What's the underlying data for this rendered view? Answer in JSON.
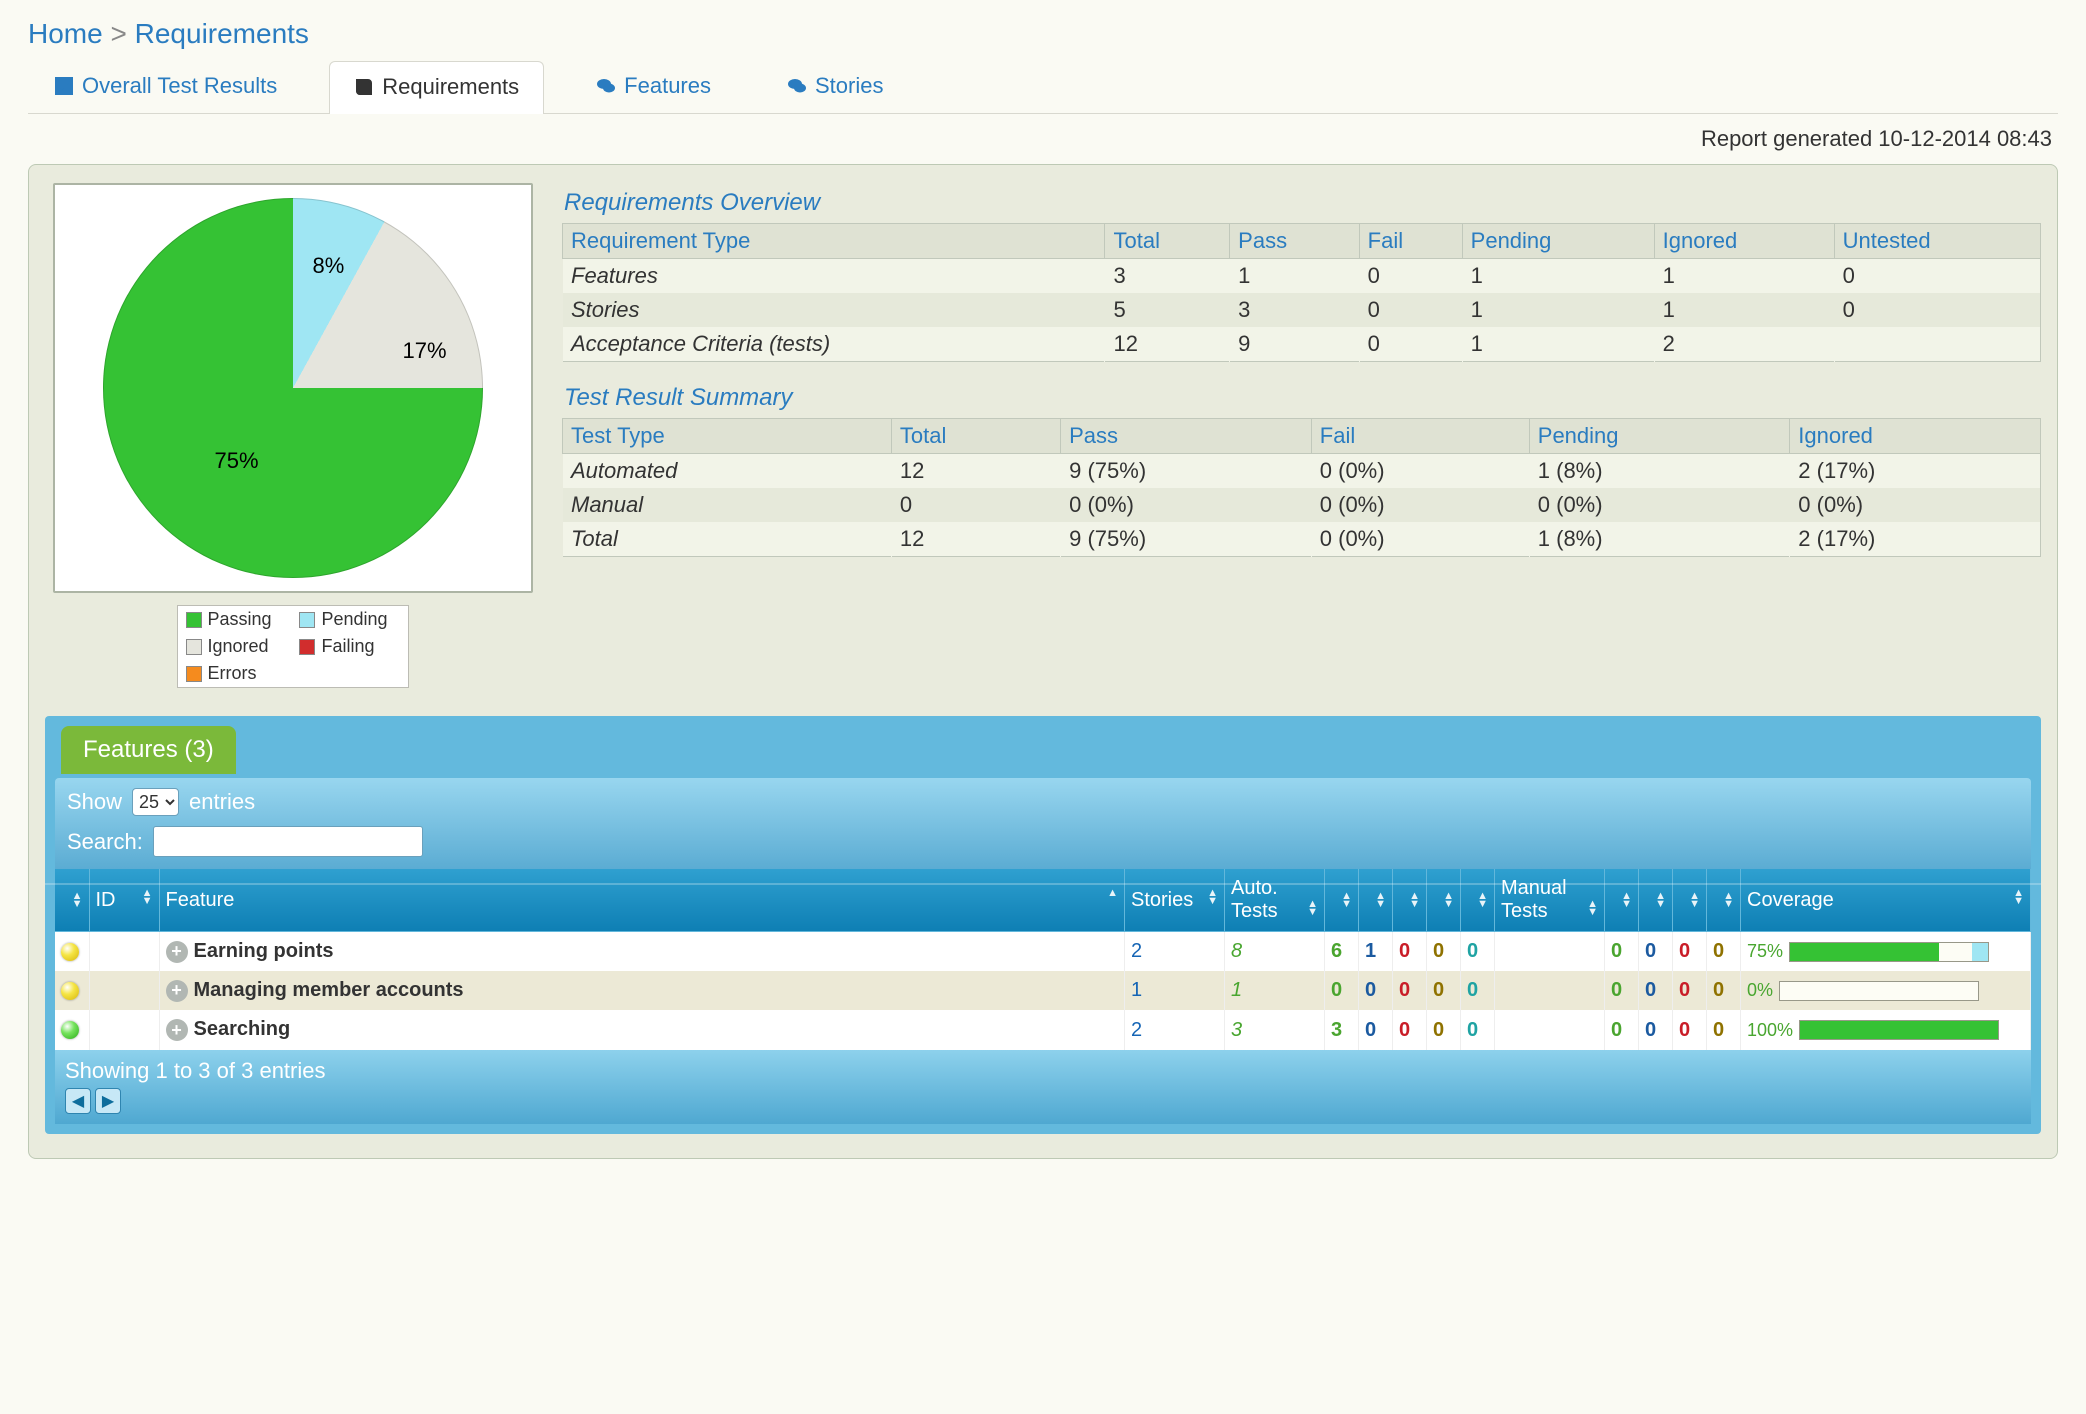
{
  "breadcrumb": {
    "home": "Home",
    "sep": ">",
    "current": "Requirements"
  },
  "tabs": {
    "overall": "Overall Test Results",
    "requirements": "Requirements",
    "features": "Features",
    "stories": "Stories"
  },
  "report_ts": "Report generated 10-12-2014 08:43",
  "pie_legend": {
    "passing": "Passing",
    "pending": "Pending",
    "ignored": "Ignored",
    "failing": "Failing",
    "errors": "Errors"
  },
  "pie_labels": {
    "pending": "8%",
    "ignored": "17%",
    "passing": "75%"
  },
  "overview_title": "Requirements Overview",
  "overview_headers": {
    "type": "Requirement Type",
    "total": "Total",
    "pass": "Pass",
    "fail": "Fail",
    "pending": "Pending",
    "ignored": "Ignored",
    "untested": "Untested"
  },
  "overview_rows": [
    {
      "type": "Features",
      "total": "3",
      "pass": "1",
      "fail": "0",
      "pending": "1",
      "ignored": "1",
      "untested": "0"
    },
    {
      "type": "Stories",
      "total": "5",
      "pass": "3",
      "fail": "0",
      "pending": "1",
      "ignored": "1",
      "untested": "0"
    },
    {
      "type": "Acceptance Criteria (tests)",
      "total": "12",
      "pass": "9",
      "fail": "0",
      "pending": "1",
      "ignored": "2",
      "untested": ""
    }
  ],
  "summary_title": "Test Result Summary",
  "summary_headers": {
    "type": "Test Type",
    "total": "Total",
    "pass": "Pass",
    "fail": "Fail",
    "pending": "Pending",
    "ignored": "Ignored"
  },
  "summary_rows": [
    {
      "type": "Automated",
      "total": "12",
      "pass": "9 (75%)",
      "fail": "0 (0%)",
      "pending": "1 (8%)",
      "ignored": "2 (17%)"
    },
    {
      "type": "Manual",
      "total": "0",
      "pass": "0 (0%)",
      "fail": "0 (0%)",
      "pending": "0 (0%)",
      "ignored": "0 (0%)"
    },
    {
      "type": "Total",
      "total": "12",
      "pass": "9 (75%)",
      "fail": "0 (0%)",
      "pending": "1 (8%)",
      "ignored": "2 (17%)"
    }
  ],
  "grid_title": "Features (3)",
  "grid_show_label_pre": "Show",
  "grid_show_value": "25",
  "grid_show_label_post": "entries",
  "grid_search_label": "Search:",
  "grid_search_value": "",
  "grid_headers": {
    "status": "",
    "id": "ID",
    "feature": "Feature",
    "stories": "Stories",
    "auto_tests": "Auto.\nTests",
    "manual_tests": "Manual\nTests",
    "coverage": "Coverage"
  },
  "features": [
    {
      "status": "yellow",
      "id": "",
      "name": "Earning points",
      "stories": "2",
      "auto_tests": "8",
      "a": [
        "6",
        "1",
        "0",
        "0",
        "0"
      ],
      "m": [
        "0",
        "0",
        "0",
        "0"
      ],
      "manual_tests": "",
      "coverage_pct": "75%",
      "coverage_fill": 75,
      "coverage_extra": 8
    },
    {
      "status": "yellow",
      "id": "",
      "name": "Managing member accounts",
      "stories": "1",
      "auto_tests": "1",
      "a": [
        "0",
        "0",
        "0",
        "0",
        "0"
      ],
      "m": [
        "0",
        "0",
        "0",
        "0"
      ],
      "manual_tests": "",
      "coverage_pct": "0%",
      "coverage_fill": 0,
      "coverage_extra": 0
    },
    {
      "status": "green",
      "id": "",
      "name": "Searching",
      "stories": "2",
      "auto_tests": "3",
      "a": [
        "3",
        "0",
        "0",
        "0",
        "0"
      ],
      "m": [
        "0",
        "0",
        "0",
        "0"
      ],
      "manual_tests": "",
      "coverage_pct": "100%",
      "coverage_fill": 100,
      "coverage_extra": 0
    }
  ],
  "grid_footer": "Showing 1 to 3 of 3 entries",
  "chart_data": {
    "type": "pie",
    "title": "",
    "slices": [
      {
        "label": "Passing",
        "value": 75,
        "color": "#35c234"
      },
      {
        "label": "Pending",
        "value": 8,
        "color": "#9fe6f3"
      },
      {
        "label": "Ignored",
        "value": 17,
        "color": "#e5e5dd"
      },
      {
        "label": "Failing",
        "value": 0,
        "color": "#d12d2d"
      },
      {
        "label": "Errors",
        "value": 0,
        "color": "#f58b1e"
      }
    ]
  }
}
